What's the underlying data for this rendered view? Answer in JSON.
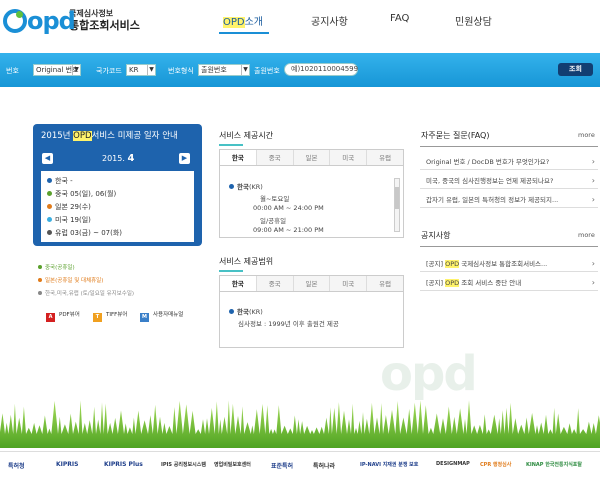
{
  "header": {
    "logo_mark": "opd",
    "logo_org": "국제심사정보",
    "logo_service": "통합조회서비스",
    "nav": [
      {
        "label_hl": "OPD",
        "label": "소개"
      },
      {
        "label": "공지사항"
      },
      {
        "label": "FAQ"
      },
      {
        "label": "민원상담"
      }
    ]
  },
  "search": {
    "number_label": "번호",
    "number_select": "Original 번호",
    "country_label": "국가코드",
    "country_select": "KR",
    "format_label": "번호형식",
    "format_select": "출원번호",
    "app_label": "출원번호",
    "app_placeholder": "예)1020110004599",
    "submit_label": "조회"
  },
  "schedule": {
    "title_pre": "2015년 ",
    "title_hl": "OPD",
    "title_post": "서비스 미제공 일자 안내",
    "prev_icon": "chevron-left-icon",
    "next_icon": "chevron-right-icon",
    "month_year": "2015.",
    "month": "4",
    "rows": [
      {
        "text": "한국 -",
        "color": "#1e63ad"
      },
      {
        "text": "중국 05(일), 06(월)",
        "color": "#5aa02c"
      },
      {
        "text": "일본 29(수)",
        "color": "#e07b1a"
      },
      {
        "text": "미국 19(일)",
        "color": "#3aaee0"
      },
      {
        "text": "유럽 03(금) ~ 07(화)",
        "color": "#555555"
      }
    ]
  },
  "legend": [
    {
      "text": "중국(공휴일)",
      "color": "#5aa02c"
    },
    {
      "text": "일본(공휴일 및 대체휴일)",
      "color": "#e07b1a"
    },
    {
      "text": "한국,미국,유럽 (토/일요일 유지보수일)",
      "color": "#888888"
    }
  ],
  "docs": [
    {
      "label": "PDF뷰어",
      "icon": "pdf-icon",
      "color": "#d42020",
      "glyph": "A"
    },
    {
      "label": "TIFF뷰어",
      "icon": "tiff-icon",
      "color": "#f0a020",
      "glyph": "T"
    },
    {
      "label": "사용자매뉴얼",
      "icon": "manual-icon",
      "color": "#3a7fc8",
      "glyph": "M"
    }
  ],
  "service_time": {
    "title": "서비스 제공시간",
    "tabs": [
      "한국",
      "중국",
      "일본",
      "미국",
      "유럽"
    ],
    "country": "한국",
    "country_code": "(KR)",
    "weekday_label": "월~토요일",
    "weekday_hours": "00:00 AM ~ 24:00 PM",
    "holiday_label": "일/공휴일",
    "holiday_hours": "09:00 AM ~ 21:00 PM"
  },
  "service_range": {
    "title": "서비스 제공범위",
    "tabs": [
      "한국",
      "중국",
      "일본",
      "미국",
      "유럽"
    ],
    "country": "한국",
    "country_code": "(KR)",
    "description": "심사정보 : 1999년 이후 출원건 제공"
  },
  "faq": {
    "title": "자주묻는 질문(FAQ)",
    "more": "more",
    "items": [
      "Original 번호 / DocDB 번호가 무엇인가요?",
      "미국, 중국의 심사진행정보는 언제 제공되나요?",
      "갑자기 유럽, 일본의 특허청의 정보가 제공되지..."
    ]
  },
  "notice": {
    "title": "공지사항",
    "more": "more",
    "items": [
      {
        "prefix": "[공지] ",
        "hl": "OPD",
        "text": " 국제심사정보 통합조회서비스..."
      },
      {
        "prefix": "[공지] ",
        "hl": "OPD",
        "text": " 조회 서비스 중단 안내"
      }
    ]
  },
  "footer_logos": [
    {
      "label": "특허청",
      "color": "#1e3e8a"
    },
    {
      "label": "KIPRIS",
      "color": "#1e3e8a"
    },
    {
      "label": "KIPRIS Plus",
      "color": "#1e3e8a"
    },
    {
      "label": "IPIS 공리정보시스템",
      "color": "#333333"
    },
    {
      "label": "영업비밀보호센터",
      "color": "#333333"
    },
    {
      "label": "표준특허",
      "color": "#1e3e8a"
    },
    {
      "label": "특허나라",
      "color": "#333333"
    },
    {
      "label": "IP-NAVI 지재권 분쟁 보호",
      "color": "#1e3e8a"
    },
    {
      "label": "DESIGNMAP",
      "color": "#333333"
    },
    {
      "label": "CPR 행정심사",
      "color": "#e07b1a"
    },
    {
      "label": "KINAP 한국전통지식포탈",
      "color": "#2b8a3e"
    }
  ]
}
